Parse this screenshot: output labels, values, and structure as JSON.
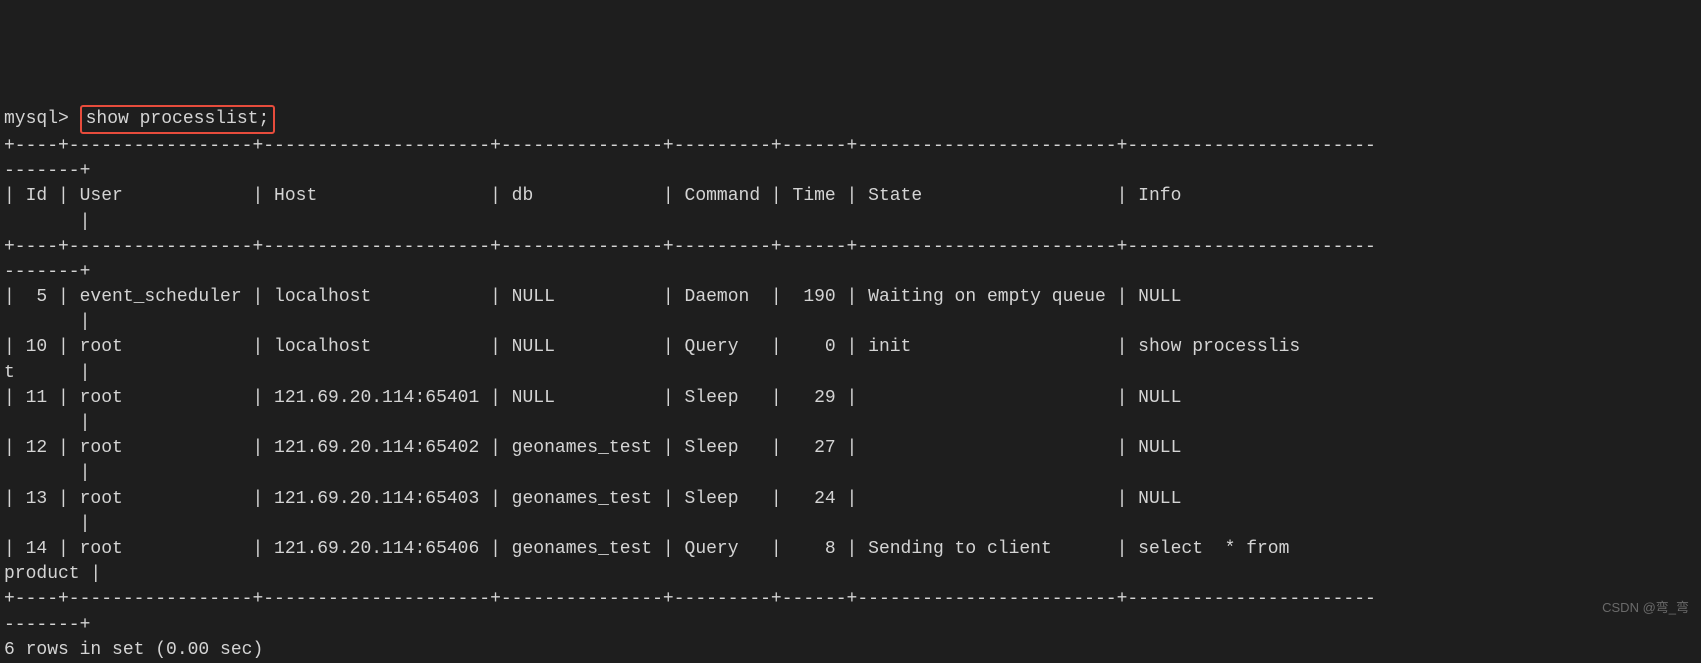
{
  "terminal": {
    "prompt": "mysql>",
    "command": "show processlist;",
    "ruler_top": "+----+-----------------+---------------------+---------------+---------+------+------------------------+-----------------------\n-------+",
    "header_row": "| Id | User            | Host                | db            | Command | Time | State                  | Info                  \n       |",
    "ruler_mid": "+----+-----------------+---------------------+---------------+---------+------+------------------------+-----------------------\n-------+",
    "columns": [
      "Id",
      "User",
      "Host",
      "db",
      "Command",
      "Time",
      "State",
      "Info"
    ],
    "rows": [
      {
        "text": "|  5 | event_scheduler | localhost           | NULL          | Daemon  |  190 | Waiting on empty queue | NULL                  \n       |"
      },
      {
        "text": "| 10 | root            | localhost           | NULL          | Query   |    0 | init                   | show processlis\nt      |"
      },
      {
        "text": "| 11 | root            | 121.69.20.114:65401 | NULL          | Sleep   |   29 |                        | NULL                  \n       |"
      },
      {
        "text": "| 12 | root            | 121.69.20.114:65402 | geonames_test | Sleep   |   27 |                        | NULL                  \n       |"
      },
      {
        "text": "| 13 | root            | 121.69.20.114:65403 | geonames_test | Sleep   |   24 |                        | NULL                  \n       |"
      },
      {
        "text": "| 14 | root            | 121.69.20.114:65406 | geonames_test | Query   |    8 | Sending to client      | select  * from \nproduct |"
      }
    ],
    "ruler_bottom": "+----+-----------------+---------------------+---------------+---------+------+------------------------+-----------------------\n-------+",
    "summary": "6 rows in set (0.00 sec)",
    "watermark": "CSDN @弯_弯"
  },
  "chart_data": {
    "type": "table",
    "title": "MySQL Process List",
    "columns": [
      "Id",
      "User",
      "Host",
      "db",
      "Command",
      "Time",
      "State",
      "Info"
    ],
    "rows": [
      [
        5,
        "event_scheduler",
        "localhost",
        "NULL",
        "Daemon",
        190,
        "Waiting on empty queue",
        "NULL"
      ],
      [
        10,
        "root",
        "localhost",
        "NULL",
        "Query",
        0,
        "init",
        "show processlist"
      ],
      [
        11,
        "root",
        "121.69.20.114:65401",
        "NULL",
        "Sleep",
        29,
        "",
        "NULL"
      ],
      [
        12,
        "root",
        "121.69.20.114:65402",
        "geonames_test",
        "Sleep",
        27,
        "",
        "NULL"
      ],
      [
        13,
        "root",
        "121.69.20.114:65403",
        "geonames_test",
        "Sleep",
        24,
        "",
        "NULL"
      ],
      [
        14,
        "root",
        "121.69.20.114:65406",
        "geonames_test",
        "Query",
        8,
        "Sending to client",
        "select  * from product"
      ]
    ]
  }
}
